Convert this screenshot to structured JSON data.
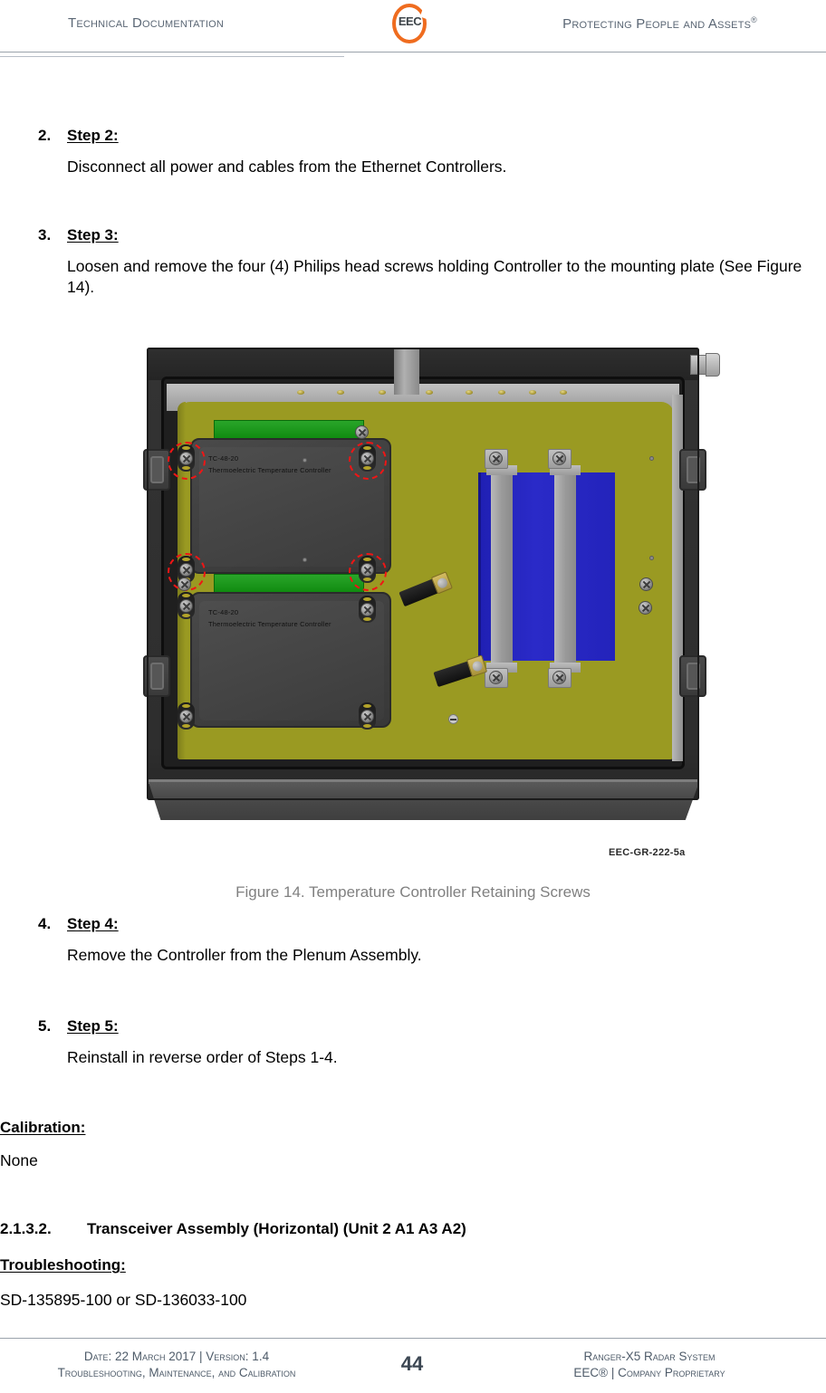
{
  "header": {
    "left_text": "Technical Documentation",
    "right_text": "Protecting People and Assets",
    "right_superscript": "®",
    "logo_text": "EEC",
    "logo_color": "#ef6c1f",
    "text_color": "#5a6674"
  },
  "steps": [
    {
      "number": "2.",
      "title": "Step 2:",
      "body": "Disconnect all power and cables from the Ethernet Controllers."
    },
    {
      "number": "3.",
      "title": "Step 3:",
      "body": "Loosen and remove the four (4) Philips head screws holding Controller to the mounting plate (See Figure 14)."
    },
    {
      "number": "4.",
      "title": "Step 4:",
      "body": "Remove the Controller from the Plenum Assembly."
    },
    {
      "number": "5.",
      "title": "Step 5:",
      "body": "Reinstall in reverse order of Steps 1-4."
    }
  ],
  "figure": {
    "caption": "Figure 14. Temperature Controller Retaining Screws",
    "caption_color": "#808080",
    "drawing_number": "EEC-GR-222-5a",
    "module_label_line1": "TC-48-20",
    "module_label_line2": "Thermoelectric Temperature Controller",
    "highlight_color": "#f01515",
    "plate_color": "#9a9a22",
    "module_color": "#424242",
    "blue_component_color": "#2323bb",
    "terminal_strip_color": "#1a9a1a",
    "enclosure_color": "#2e2e2e",
    "highlighted_screw_count": 4
  },
  "calibration": {
    "heading": "Calibration:",
    "body": "None"
  },
  "section": {
    "number": "2.1.3.2.",
    "title": "Transceiver Assembly (Horizontal) (Unit 2 A1 A3 A2)"
  },
  "troubleshooting": {
    "heading": "Troubleshooting:",
    "body": "SD-135895-100 or SD-136033-100"
  },
  "footer": {
    "left_line1": "Date: 22 March 2017 | Version: 1.4",
    "left_line2": "Troubleshooting, Maintenance, and Calibration",
    "page_number": "44",
    "right_line1": "Ranger-X5 Radar System",
    "right_line2": "EEC® | Company Proprietary",
    "text_color": "#4e5b69"
  }
}
